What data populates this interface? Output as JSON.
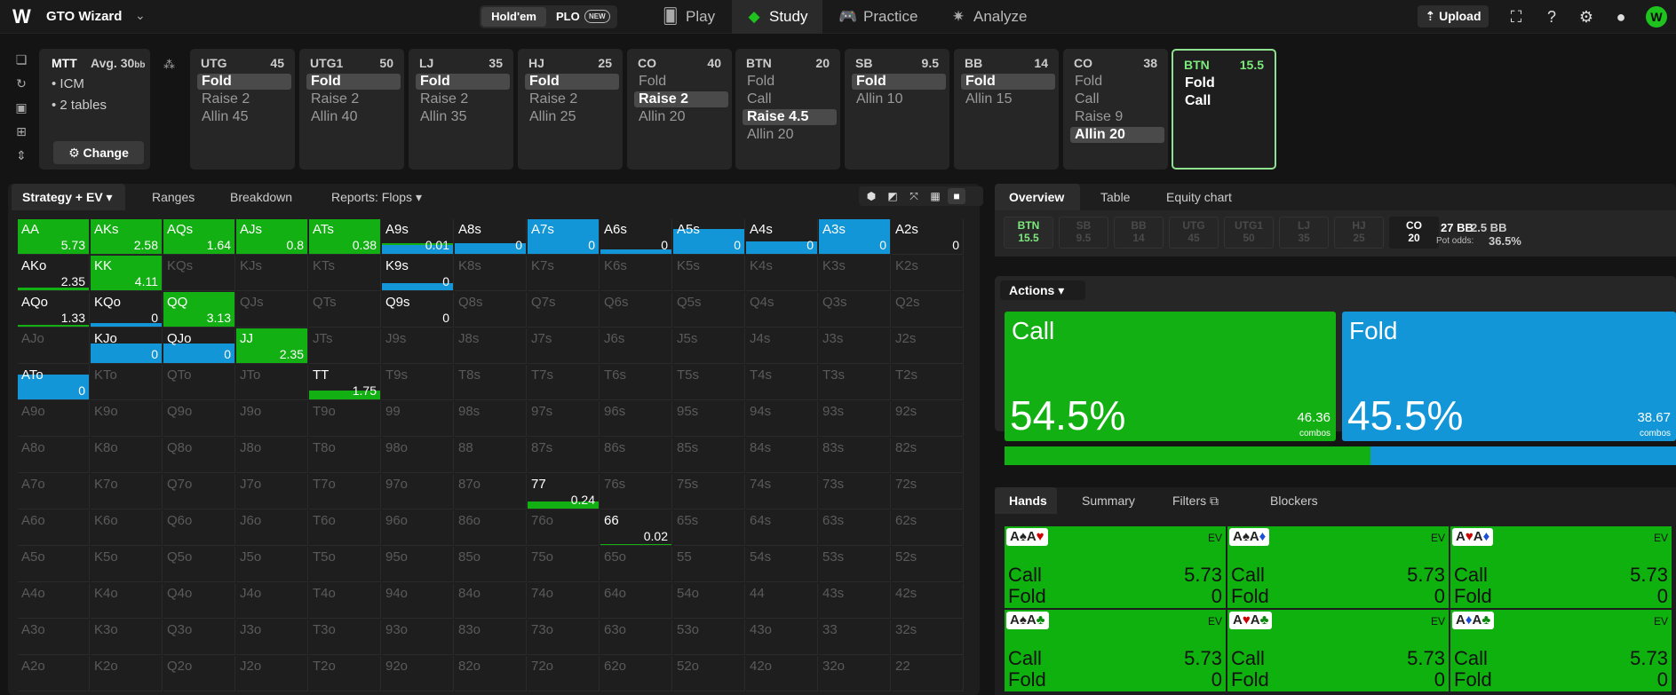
{
  "app": {
    "title": "GTO Wizard",
    "logo_letter": "W"
  },
  "game_toggle": {
    "holdem": "Hold'em",
    "plo": "PLO",
    "new_badge": "NEW"
  },
  "nav": {
    "play": "Play",
    "study": "Study",
    "practice": "Practice",
    "analyze": "Analyze"
  },
  "top_right": {
    "upload": "Upload"
  },
  "colors": {
    "green": "#1ec31e",
    "blue": "#1296d8",
    "grid_green": "#13b013",
    "accent_green": "#7cea7c"
  },
  "tournament": {
    "type": "MTT",
    "avg_label": "Avg. 30",
    "avg_unit": "bb",
    "bullet_1": "ICM",
    "bullet_2": "2 tables",
    "change": "Change"
  },
  "positions": [
    {
      "name": "UTG",
      "stack": "45",
      "actions": [
        "Fold",
        "Raise 2",
        "Allin 45"
      ],
      "selected": 0
    },
    {
      "name": "UTG1",
      "stack": "50",
      "actions": [
        "Fold",
        "Raise 2",
        "Allin 40"
      ],
      "selected": 0
    },
    {
      "name": "LJ",
      "stack": "35",
      "actions": [
        "Fold",
        "Raise 2",
        "Allin 35"
      ],
      "selected": 0
    },
    {
      "name": "HJ",
      "stack": "25",
      "actions": [
        "Fold",
        "Raise 2",
        "Allin 25"
      ],
      "selected": 0
    },
    {
      "name": "CO",
      "stack": "40",
      "actions": [
        "Fold",
        "Raise 2",
        "Allin 20"
      ],
      "selected": 1
    },
    {
      "name": "BTN",
      "stack": "20",
      "actions": [
        "Fold",
        "Call",
        "Raise 4.5",
        "Allin 20"
      ],
      "selected": 2
    },
    {
      "name": "SB",
      "stack": "9.5",
      "actions": [
        "Fold",
        "Allin 10"
      ],
      "selected": 0
    },
    {
      "name": "BB",
      "stack": "14",
      "actions": [
        "Fold",
        "Allin 15"
      ],
      "selected": 0
    },
    {
      "name": "CO",
      "stack": "38",
      "actions": [
        "Fold",
        "Call",
        "Raise 9",
        "Allin 20"
      ],
      "selected": 3
    },
    {
      "name": "BTN",
      "stack": "15.5",
      "actions": [
        "Fold",
        "Call"
      ],
      "selected": -1,
      "current": true
    }
  ],
  "left_tabs": {
    "strategy": "Strategy + EV",
    "ranges": "Ranges",
    "breakdown": "Breakdown",
    "reports": "Reports: Flops"
  },
  "matrix": {
    "ranks": [
      "A",
      "K",
      "Q",
      "J",
      "T",
      "9",
      "8",
      "7",
      "6",
      "5",
      "4",
      "3",
      "2"
    ],
    "hands": {
      "AA": {
        "ev": "5.73",
        "call": 1.0
      },
      "AKs": {
        "ev": "2.58",
        "call": 1.0
      },
      "AQs": {
        "ev": "1.64",
        "call": 1.0
      },
      "AJs": {
        "ev": "0.8",
        "call": 1.0
      },
      "ATs": {
        "ev": "0.38",
        "call": 1.0
      },
      "A9s": {
        "ev": "0.01",
        "call": 0.05,
        "fold": 0.25
      },
      "A8s": {
        "ev": "0",
        "fold": 0.3
      },
      "A7s": {
        "ev": "0",
        "fold": 1.0
      },
      "A6s": {
        "ev": "0",
        "fold": 0.12
      },
      "A5s": {
        "ev": "0",
        "fold": 0.7
      },
      "A4s": {
        "ev": "0",
        "fold": 0.35
      },
      "A3s": {
        "ev": "0",
        "fold": 1.0
      },
      "A2s": {
        "ev": "0"
      },
      "AKo": {
        "ev": "2.35",
        "call": 0.08
      },
      "KK": {
        "ev": "4.11",
        "call": 1.0
      },
      "K9s": {
        "ev": "0",
        "fold": 0.2
      },
      "AQo": {
        "ev": "1.33",
        "call": 0.06
      },
      "KQo": {
        "ev": "0",
        "fold": 0.1
      },
      "QQ": {
        "ev": "3.13",
        "call": 1.0
      },
      "Q9s": {
        "ev": "0"
      },
      "KJo": {
        "ev": "0",
        "fold": 0.55
      },
      "QJo": {
        "ev": "0",
        "fold": 0.55
      },
      "JJ": {
        "ev": "2.35",
        "call": 1.0
      },
      "ATo": {
        "ev": "0",
        "fold": 0.7
      },
      "TT": {
        "ev": "1.75",
        "call": 0.25
      },
      "77": {
        "ev": "0.24",
        "call": 0.2
      },
      "66": {
        "ev": "0.02",
        "call": 0.03
      }
    }
  },
  "right_tabs": {
    "overview": "Overview",
    "table": "Table",
    "equity_chart": "Equity chart"
  },
  "seats": [
    {
      "name": "BTN",
      "stack": "15.5",
      "style": "green"
    },
    {
      "name": "SB",
      "stack": "9.5",
      "style": "dim"
    },
    {
      "name": "BB",
      "stack": "14",
      "style": "dim"
    },
    {
      "name": "UTG",
      "stack": "45",
      "style": "dim"
    },
    {
      "name": "UTG1",
      "stack": "50",
      "style": "dim"
    },
    {
      "name": "LJ",
      "stack": "35",
      "style": "dim"
    },
    {
      "name": "HJ",
      "stack": "25",
      "style": "dim"
    },
    {
      "name": "CO",
      "stack": "20",
      "style": "white"
    }
  ],
  "pot": {
    "main": "27 BB",
    "side": "2.5 BB",
    "odds_label": "Pot odds:",
    "odds_value": "36.5%"
  },
  "actions": {
    "dropdown": "Actions",
    "call": {
      "name": "Call",
      "percent": "54.5%",
      "combos": "46.36",
      "combos_label": "combos",
      "freq": 0.545
    },
    "fold": {
      "name": "Fold",
      "percent": "45.5%",
      "combos": "38.67",
      "combos_label": "combos",
      "freq": 0.455
    }
  },
  "hands_tabs": {
    "hands": "Hands",
    "summary": "Summary",
    "filters": "Filters",
    "blockers": "Blockers"
  },
  "hand_cards": [
    {
      "cards": [
        [
          "A",
          "♠",
          "blk"
        ],
        [
          "A",
          "♥",
          "red"
        ]
      ],
      "ev_label": "EV",
      "call_label": "Call",
      "call_ev": "5.73",
      "fold_label": "Fold",
      "fold_ev": "0"
    },
    {
      "cards": [
        [
          "A",
          "♠",
          "blk"
        ],
        [
          "A",
          "♦",
          "blu"
        ]
      ],
      "ev_label": "EV",
      "call_label": "Call",
      "call_ev": "5.73",
      "fold_label": "Fold",
      "fold_ev": "0"
    },
    {
      "cards": [
        [
          "A",
          "♥",
          "red"
        ],
        [
          "A",
          "♦",
          "blu"
        ]
      ],
      "ev_label": "EV",
      "call_label": "Call",
      "call_ev": "5.73",
      "fold_label": "Fold",
      "fold_ev": "0"
    },
    {
      "cards": [
        [
          "A",
          "♠",
          "blk"
        ],
        [
          "A",
          "♣",
          "grn"
        ]
      ],
      "ev_label": "EV",
      "call_label": "Call",
      "call_ev": "5.73",
      "fold_label": "Fold",
      "fold_ev": "0"
    },
    {
      "cards": [
        [
          "A",
          "♥",
          "red"
        ],
        [
          "A",
          "♣",
          "grn"
        ]
      ],
      "ev_label": "EV",
      "call_label": "Call",
      "call_ev": "5.73",
      "fold_label": "Fold",
      "fold_ev": "0"
    },
    {
      "cards": [
        [
          "A",
          "♦",
          "blu"
        ],
        [
          "A",
          "♣",
          "grn"
        ]
      ],
      "ev_label": "EV",
      "call_label": "Call",
      "call_ev": "5.73",
      "fold_label": "Fold",
      "fold_ev": "0"
    }
  ]
}
